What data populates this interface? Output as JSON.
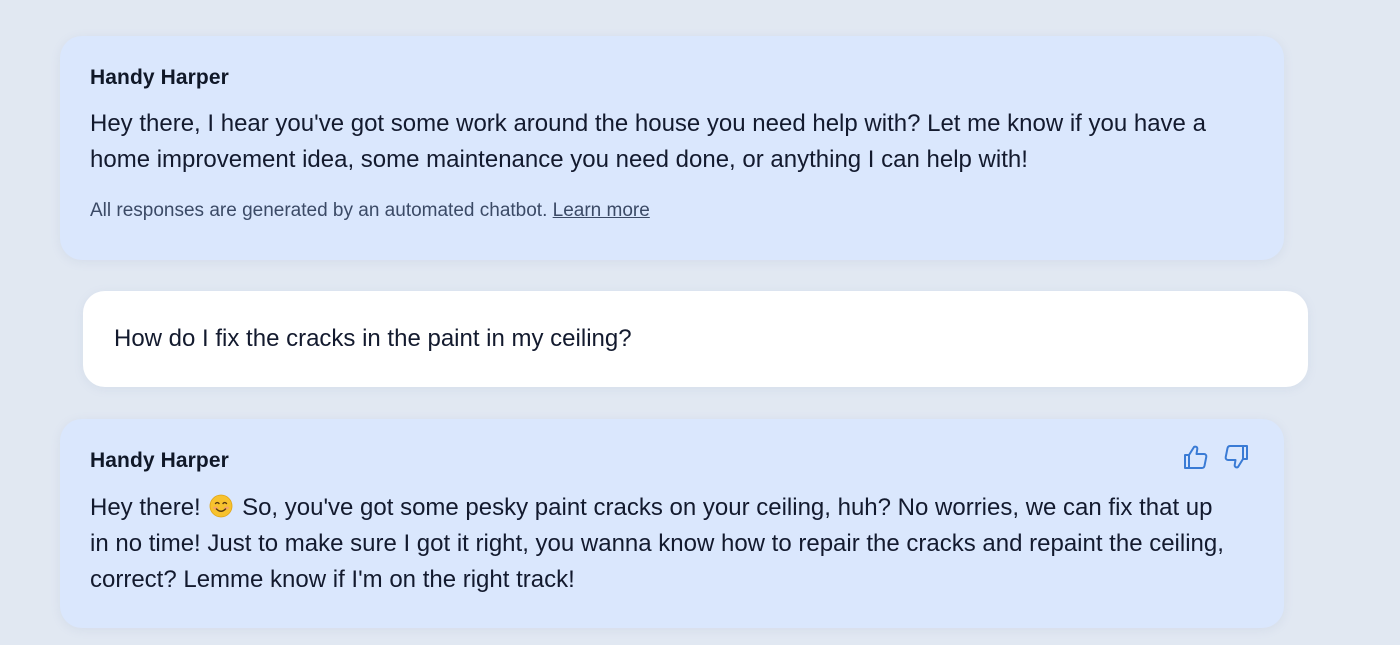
{
  "conversation": {
    "greeting": {
      "sender": "Handy Harper",
      "text": "Hey there, I hear you've got some work around the house you need help with? Let me know if you have a home improvement idea, some maintenance you need done, or anything I can help with!",
      "disclaimer": "All responses are generated by an automated chatbot.",
      "learn_more": "Learn more"
    },
    "user_message": {
      "text": "How do I fix the cracks in the paint in my ceiling?"
    },
    "reply": {
      "sender": "Handy Harper",
      "text_before_emoji": "Hey there!",
      "emoji": "smiling-face-emoji",
      "text_after_emoji": "So, you've got some pesky paint cracks on your ceiling, huh? No worries, we can fix that up in no time! Just to make sure I got it right, you wanna know how to repair the cracks and repaint the ceiling, correct? Lemme know if I'm on the right track!",
      "feedback": {
        "thumbs_up_icon": "thumbs-up-icon",
        "thumbs_down_icon": "thumbs-down-icon"
      }
    }
  },
  "colors": {
    "page_background": "#e1e8f2",
    "bot_bubble": "#dae7fd",
    "user_bubble": "#ffffff",
    "accent": "#3a7bd5",
    "text": "#131a2e",
    "muted_text": "#3b4a66"
  }
}
